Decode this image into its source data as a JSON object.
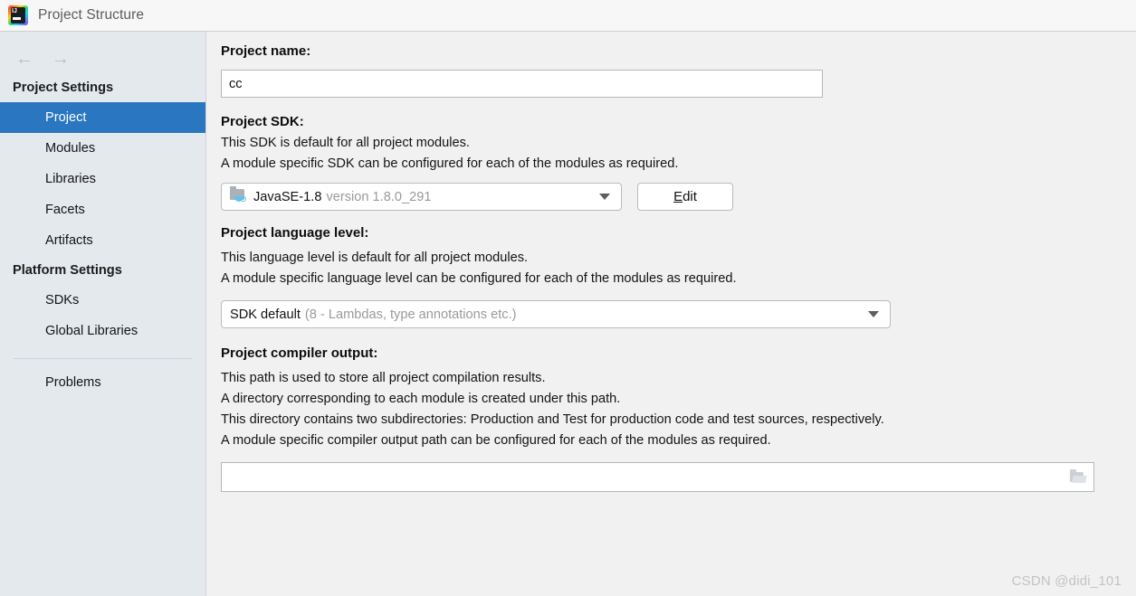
{
  "window": {
    "title": "Project Structure",
    "app_icon": "intellij-idea-icon"
  },
  "nav": {
    "back_icon": "arrow-left-icon",
    "forward_icon": "arrow-right-icon"
  },
  "sidebar": {
    "groups": [
      {
        "label": "Project Settings",
        "items": [
          {
            "label": "Project",
            "selected": true
          },
          {
            "label": "Modules",
            "selected": false
          },
          {
            "label": "Libraries",
            "selected": false
          },
          {
            "label": "Facets",
            "selected": false
          },
          {
            "label": "Artifacts",
            "selected": false
          }
        ]
      },
      {
        "label": "Platform Settings",
        "items": [
          {
            "label": "SDKs",
            "selected": false
          },
          {
            "label": "Global Libraries",
            "selected": false
          }
        ]
      }
    ],
    "problems_label": "Problems",
    "selected_bg": "#2a76c0",
    "bg": "#e4e9ee"
  },
  "main": {
    "project_name": {
      "label": "Project name:",
      "value": "cc"
    },
    "project_sdk": {
      "label": "Project SDK:",
      "desc_line1": "This SDK is default for all project modules.",
      "desc_line2": "A module specific SDK can be configured for each of the modules as required.",
      "selected_name": "JavaSE-1.8",
      "selected_version": "version 1.8.0_291",
      "sdk_icon": "jdk-folder-icon",
      "dropdown_icon": "chevron-down-icon",
      "edit_button": {
        "mnemonic": "E",
        "rest": "dit"
      }
    },
    "language_level": {
      "label": "Project language level:",
      "desc_line1": "This language level is default for all project modules.",
      "desc_line2": "A module specific language level can be configured for each of the modules as required.",
      "selected_name": "SDK default",
      "selected_detail": "(8 - Lambdas, type annotations etc.)",
      "dropdown_icon": "chevron-down-icon"
    },
    "compiler_output": {
      "label": "Project compiler output:",
      "desc_line1": "This path is used to store all project compilation results.",
      "desc_line2": "A directory corresponding to each module is created under this path.",
      "desc_line3": "This directory contains two subdirectories: Production and Test for production code and test sources, respectively.",
      "desc_line4": "A module specific compiler output path can be configured for each of the modules as required.",
      "value": "",
      "browse_icon": "folder-open-icon"
    }
  },
  "watermark": {
    "text": "CSDN @didi_101"
  }
}
